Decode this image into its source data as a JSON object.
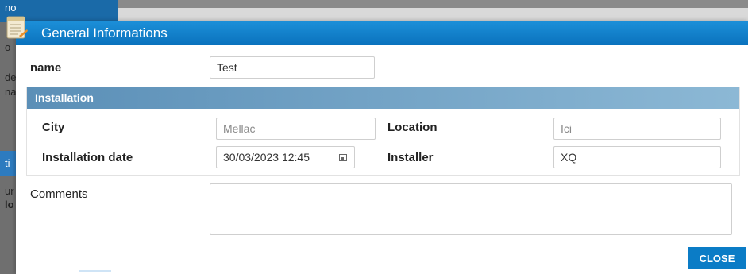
{
  "background": {
    "top_text": "no",
    "side_fragments": [
      "o",
      "de",
      "na",
      "ti",
      "ur",
      "lo"
    ]
  },
  "dialog": {
    "title": "General Informations",
    "name_label": "name",
    "name_value": "Test",
    "installation": {
      "header": "Installation",
      "city_label": "City",
      "city_value": "Mellac",
      "location_label": "Location",
      "location_value": "Ici",
      "date_label": "Installation date",
      "date_value": "30/03/2023 12:45",
      "installer_label": "Installer",
      "installer_value": "XQ"
    },
    "comments_label": "Comments",
    "comments_value": "",
    "close_label": "CLOSE"
  },
  "colors": {
    "header": "#0a72bd",
    "group_header": "#5b8fb7",
    "button": "#0b7cc6"
  }
}
